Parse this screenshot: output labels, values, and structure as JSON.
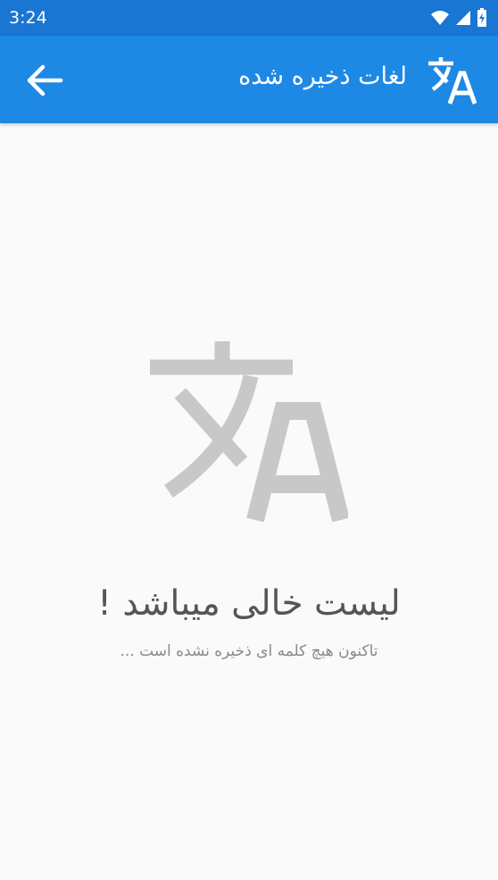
{
  "status_bar": {
    "time": "3:24",
    "icons": [
      "wifi-icon",
      "signal-icon",
      "battery-icon"
    ]
  },
  "app_bar": {
    "title": "لغات ذخیره شده",
    "back_icon": "arrow-back-icon",
    "logo_icon": "translate-icon"
  },
  "empty_state": {
    "illustration_icon": "translate-icon",
    "title": "لیست خالی میباشد !",
    "subtitle": "تاکنون هیچ کلمه ای ذخیره نشده است ..."
  },
  "colors": {
    "status_bar": "#1976d2",
    "app_bar": "#1e88e5",
    "background": "#fafafa",
    "illustration": "#c8c8c8",
    "title_text": "#555555",
    "subtitle_text": "#8a8a8a"
  }
}
